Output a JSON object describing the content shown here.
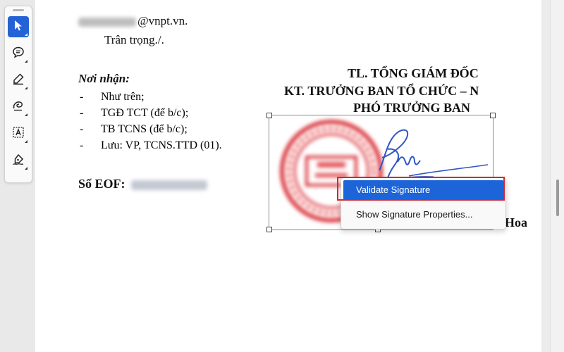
{
  "toolbar": {
    "tools": [
      {
        "name": "select",
        "icon": "cursor-arrow-icon",
        "active": true
      },
      {
        "name": "comment",
        "icon": "comment-bubble-icon",
        "active": false
      },
      {
        "name": "highlight",
        "icon": "pen-icon",
        "active": false
      },
      {
        "name": "draw",
        "icon": "freehand-loop-icon",
        "active": false
      },
      {
        "name": "text",
        "icon": "text-box-icon",
        "active": false
      },
      {
        "name": "sign",
        "icon": "signature-pen-icon",
        "active": false
      }
    ],
    "accent": "#2463d6"
  },
  "document": {
    "email_suffix": "@vnpt.vn.",
    "closing": "Trân trọng./.",
    "recipients_title": "Nơi nhận:",
    "recipients": [
      "Như trên;",
      "TGĐ TCT (để b/c);",
      "TB TCNS (để b/c);",
      "Lưu: VP, TCNS.TTD (01)."
    ],
    "recipient_bullet": "-",
    "eof_label": "Số EOF:",
    "signer_title_line1": "TL. TỔNG GIÁM ĐỐC",
    "signer_title_line2": "KT. TRƯỞNG BAN TỔ CHỨC – N",
    "signer_title_line3": "PHÓ TRƯỞNG BAN",
    "signer_name_fragment": "Hoa"
  },
  "context_menu": {
    "items": [
      {
        "label": "Validate Signature",
        "highlighted": true
      },
      {
        "label": "Show Signature Properties...",
        "highlighted": false
      }
    ],
    "highlight_color": "#1c64d8",
    "outline_color": "#d7262b"
  },
  "colors": {
    "stamp_red": "#d9363e",
    "signature_blue": "#2f56c4"
  }
}
